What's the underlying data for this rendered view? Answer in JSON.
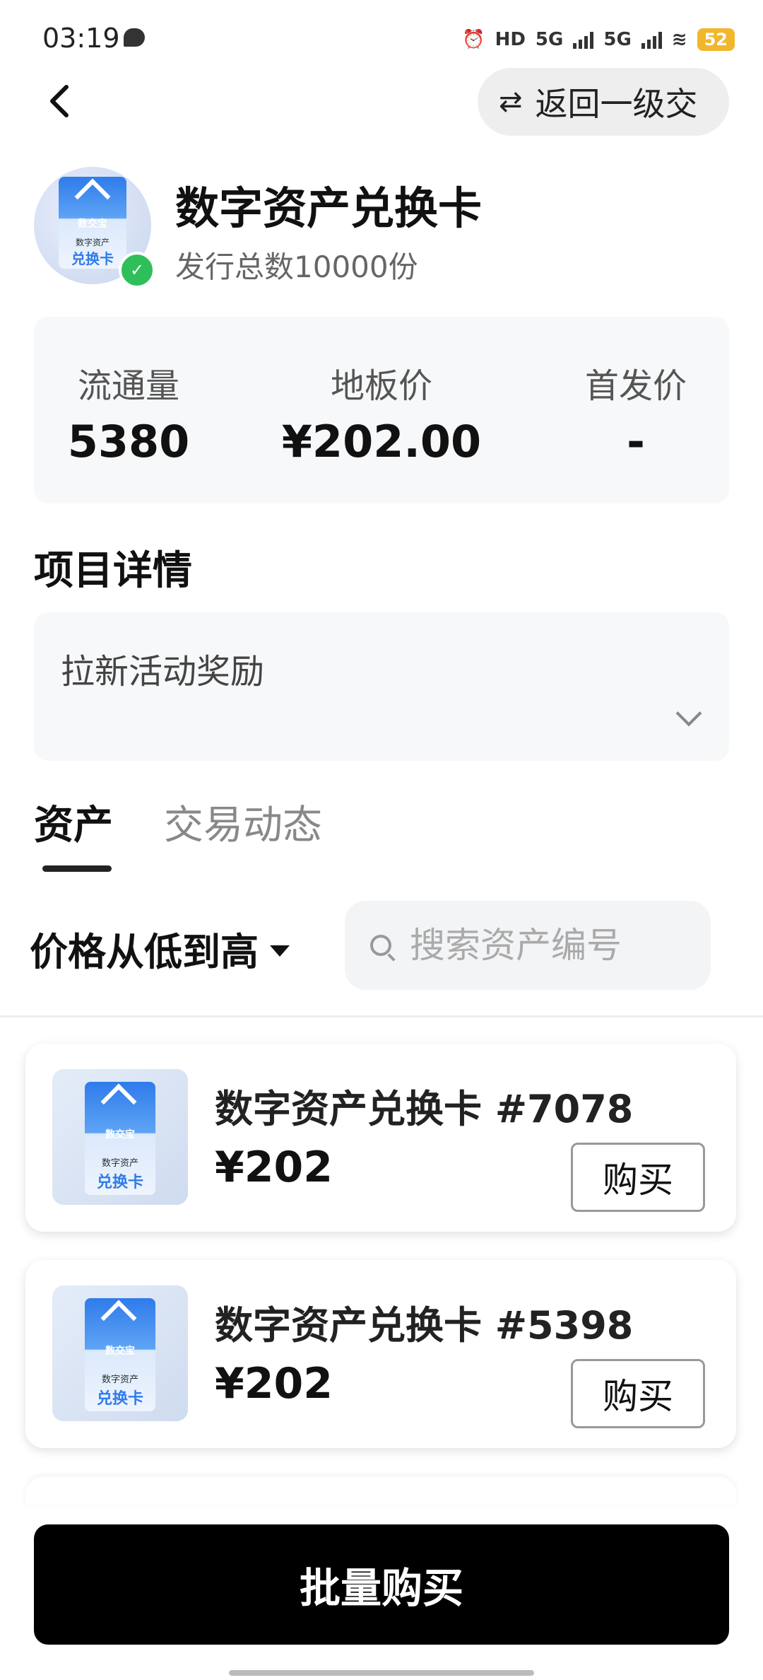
{
  "status_bar": {
    "time": "03:19",
    "hd_label": "HD",
    "sim_a_label": "5G",
    "sim_b_label": "5G",
    "battery": "52"
  },
  "header": {
    "back_icon": "chevron-left-icon",
    "switch_label": "返回一级交"
  },
  "asset": {
    "title": "数字资产兑换卡",
    "subtitle": "发行总数10000份",
    "badge_brand": "数交宝",
    "badge_sub": "数字资产",
    "badge_kw": "兑换卡"
  },
  "stats": {
    "circulation_label": "流通量",
    "circulation_value": "5380",
    "floor_label": "地板价",
    "floor_value": "¥202.00",
    "initial_label": "首发价",
    "initial_value": "-"
  },
  "details": {
    "section_title": "项目详情",
    "text": "拉新活动奖励"
  },
  "tabs": [
    {
      "label": "资产",
      "active": true
    },
    {
      "label": "交易动态",
      "active": false
    }
  ],
  "filters": {
    "sort_label": "价格从低到高",
    "search_placeholder": "搜索资产编号",
    "search_value": ""
  },
  "listings": [
    {
      "title": "数字资产兑换卡 #7078",
      "price": "¥202",
      "buy_label": "购买"
    },
    {
      "title": "数字资产兑换卡 #5398",
      "price": "¥202",
      "buy_label": "购买"
    }
  ],
  "bulk_buy_label": "批量购买",
  "colors": {
    "accent": "#2f7bea",
    "verified": "#2fbf5a",
    "primary_button": "#000000",
    "battery": "#f2b62c"
  }
}
